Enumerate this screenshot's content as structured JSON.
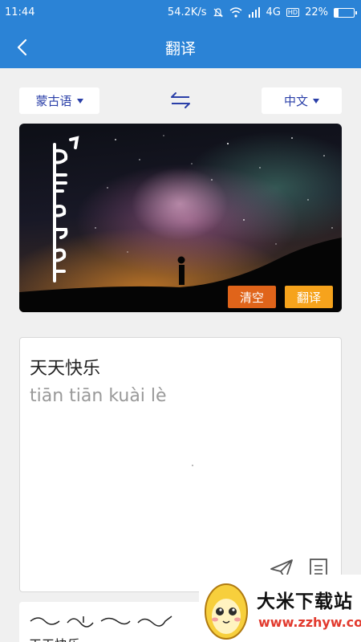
{
  "status_bar": {
    "time": "11:44",
    "network_speed": "54.2K/s",
    "network_type": "4G",
    "hd_badge": "HD",
    "battery_percent": "22%",
    "battery_level": 0.22
  },
  "app_bar": {
    "title": "翻译"
  },
  "languages": {
    "source": "蒙古语",
    "target": "中文"
  },
  "image_panel": {
    "clear_label": "清空",
    "translate_label": "翻译"
  },
  "result": {
    "text": "天天快乐",
    "pinyin": "tiān tiān kuài lè"
  },
  "history": {
    "text": "天天快乐"
  },
  "watermark": {
    "title": "大米下载站",
    "url": "www.zzhyw.com"
  },
  "colors": {
    "primary": "#2b83d6",
    "clear_button": "#e0641a",
    "translate_button": "#f6a31c",
    "language_text": "#2a3fa8"
  }
}
